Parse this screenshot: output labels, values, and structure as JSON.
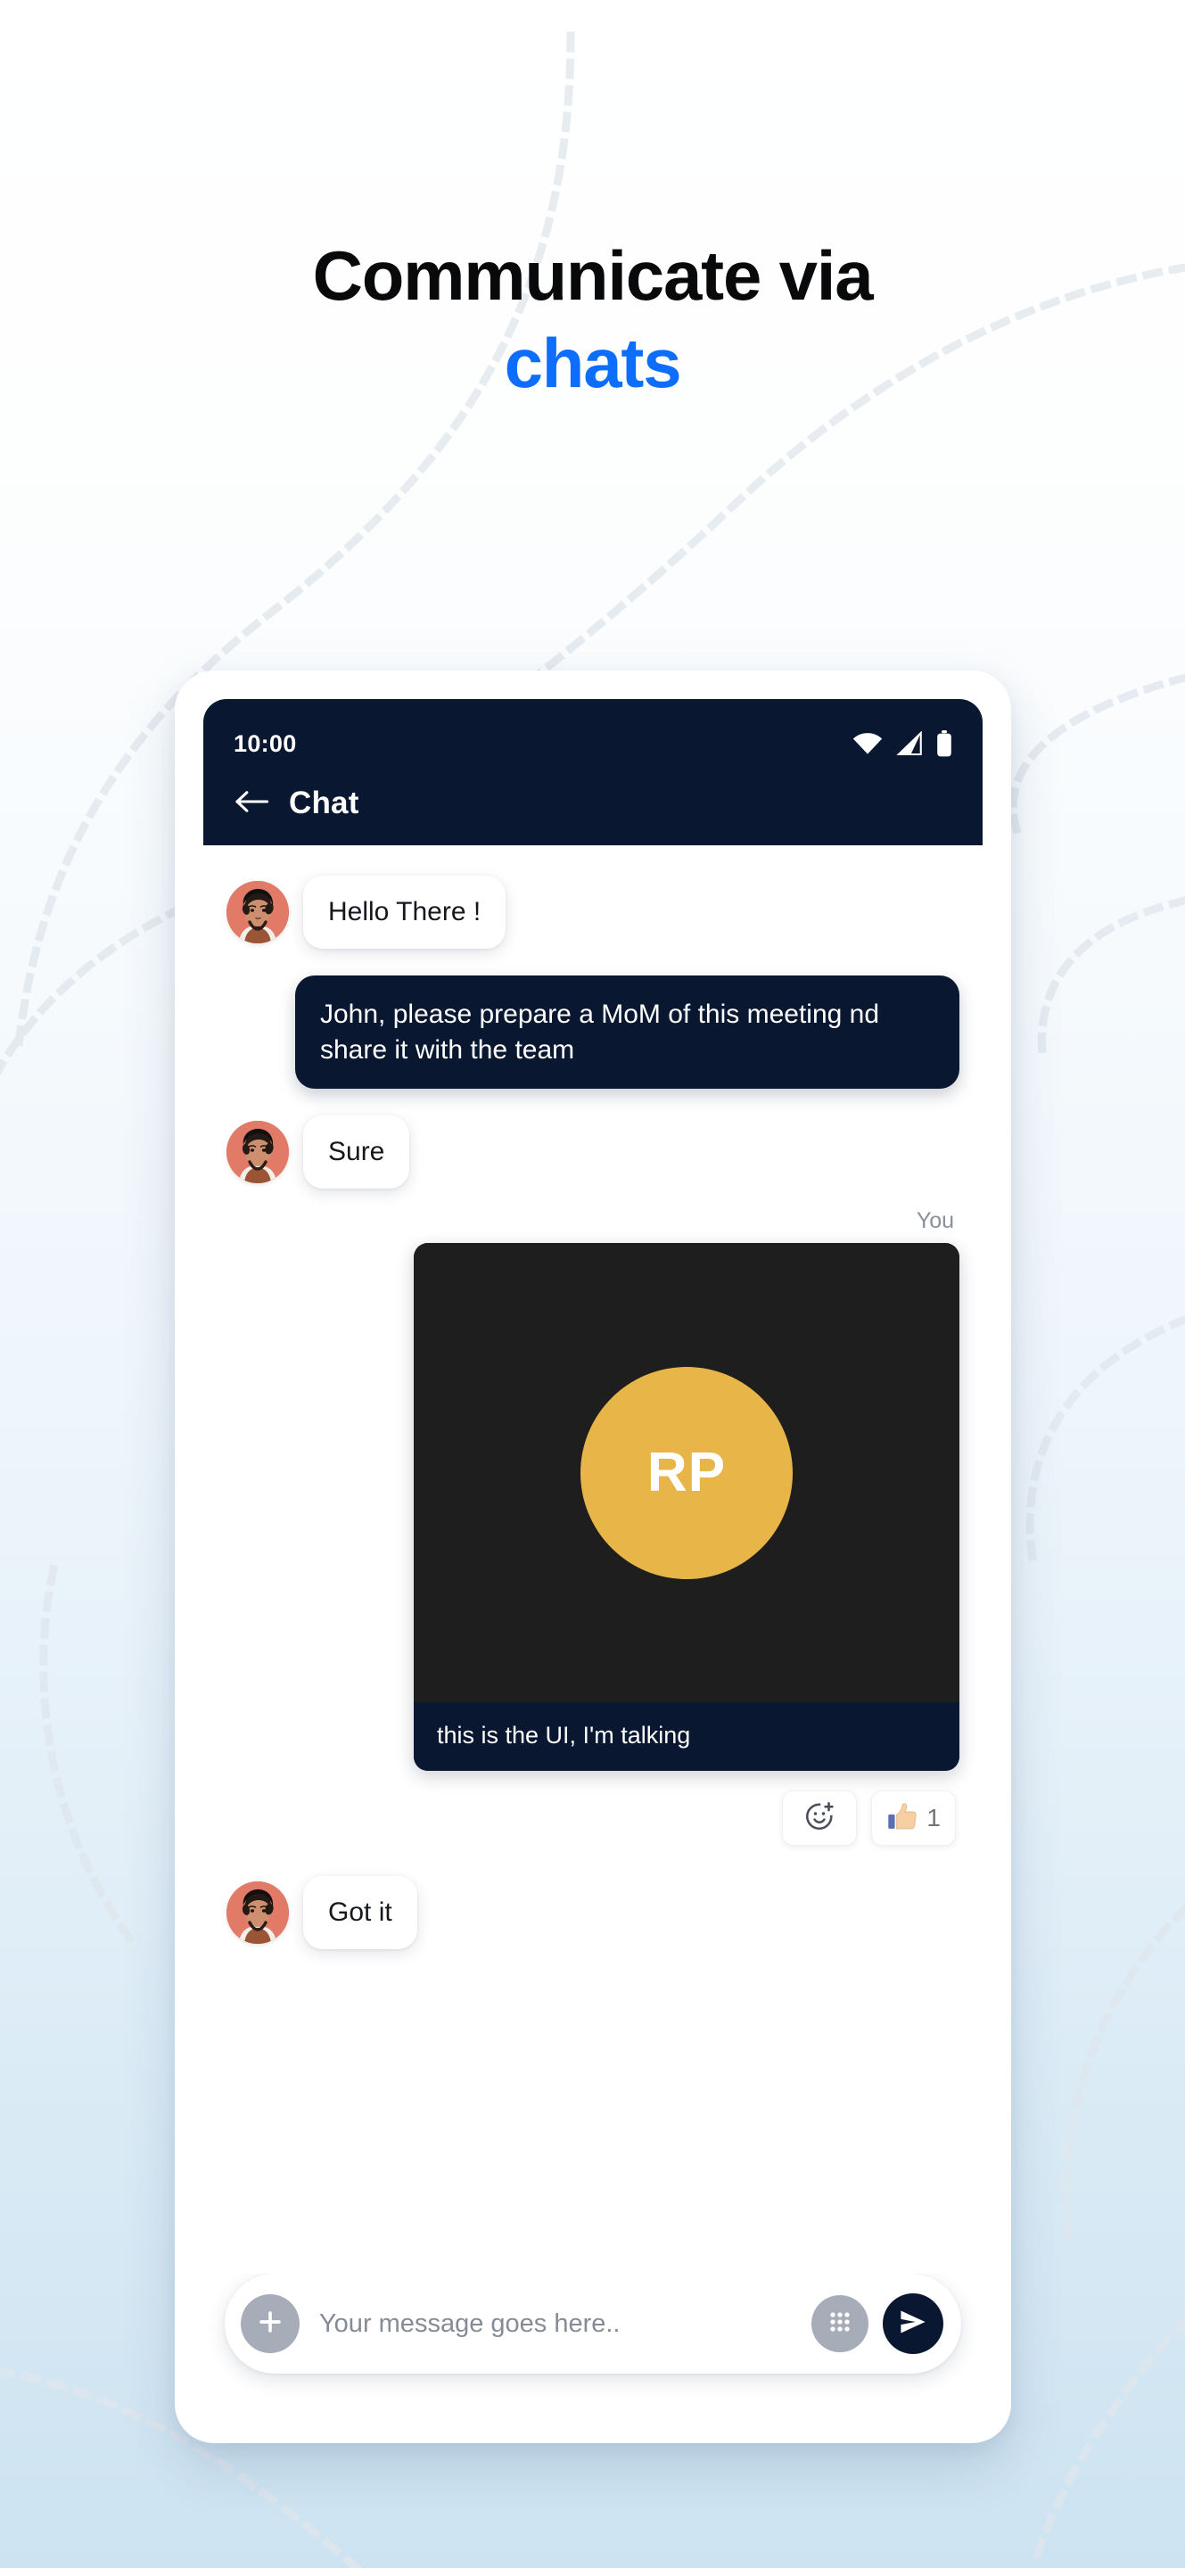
{
  "headline": {
    "line1": "Communicate via",
    "line2": "chats",
    "line1_color": "#08090b",
    "line2_color": "#0d6efd"
  },
  "phone": {
    "status_bar": {
      "time": "10:00",
      "icons": [
        "wifi-icon",
        "cellular-signal-icon",
        "battery-icon"
      ]
    },
    "app_bar": {
      "back_icon": "arrow-left-icon",
      "title": "Chat",
      "background_color": "#0a1730"
    },
    "messages": [
      {
        "id": "m1",
        "side": "incoming",
        "avatar": "contact-avatar",
        "text": "Hello There !"
      },
      {
        "id": "m2",
        "side": "outgoing",
        "text": "John, please prepare a MoM of this meeting nd share it with the team"
      },
      {
        "id": "m3",
        "side": "incoming",
        "avatar": "contact-avatar",
        "text": "Sure"
      },
      {
        "id": "m4",
        "side": "outgoing",
        "sender_label": "You",
        "type": "media",
        "media": {
          "initials": "RP",
          "circle_color": "#e8b548",
          "backdrop_color": "#1e1e1e",
          "caption": "this is the UI, I'm talking"
        },
        "reactions": [
          {
            "icon": "add-reaction-icon",
            "count": ""
          },
          {
            "icon": "thumbs-up-icon",
            "count": "1"
          }
        ]
      },
      {
        "id": "m5",
        "side": "incoming",
        "avatar": "contact-avatar",
        "text": "Got it"
      }
    ],
    "composer": {
      "attach_icon": "plus-icon",
      "placeholder": "Your message goes here..",
      "value": "",
      "apps_icon": "grid-apps-icon",
      "send_icon": "send-paper-plane-icon",
      "send_color": "#0a1730"
    }
  },
  "theme": {
    "accent_blue": "#0d6efd",
    "dark_navy": "#0a1730",
    "bg_top": "#ffffff",
    "bg_bottom": "#cde3f1",
    "avatar_bg": "#e17a66"
  }
}
